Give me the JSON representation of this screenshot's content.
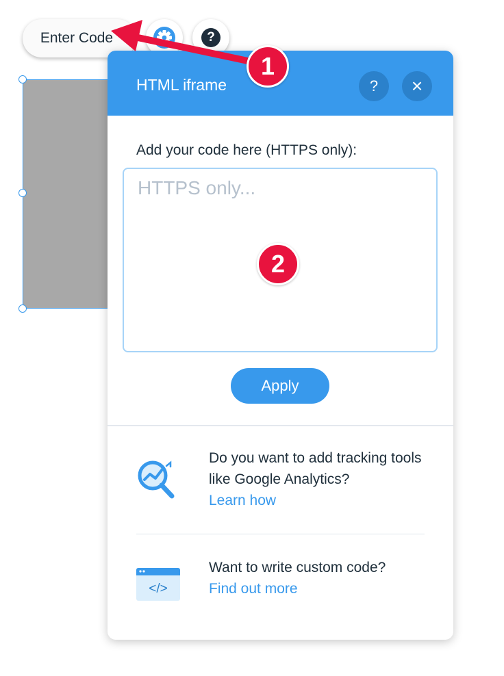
{
  "toolbar": {
    "enter_code_label": "Enter Code",
    "gear_icon": "gear-icon",
    "help_label": "?"
  },
  "panel": {
    "title": "HTML iframe",
    "help_label": "?",
    "close_label": "×",
    "field_label": "Add your code here (HTTPS only):",
    "input_value": "",
    "input_placeholder": "HTTPS only...",
    "apply_label": "Apply",
    "analytics": {
      "text": "Do you want to add tracking tools like Google Analytics?",
      "link": "Learn how"
    },
    "custom_code": {
      "text": "Want to write custom code?",
      "link": "Find out more",
      "icon_glyph": "</>"
    }
  },
  "annotations": {
    "step1": "1",
    "step2": "2"
  },
  "colors": {
    "accent": "#3899ec",
    "header_button": "#2b81cb",
    "annotation": "#e8133e",
    "text": "#20303c"
  }
}
